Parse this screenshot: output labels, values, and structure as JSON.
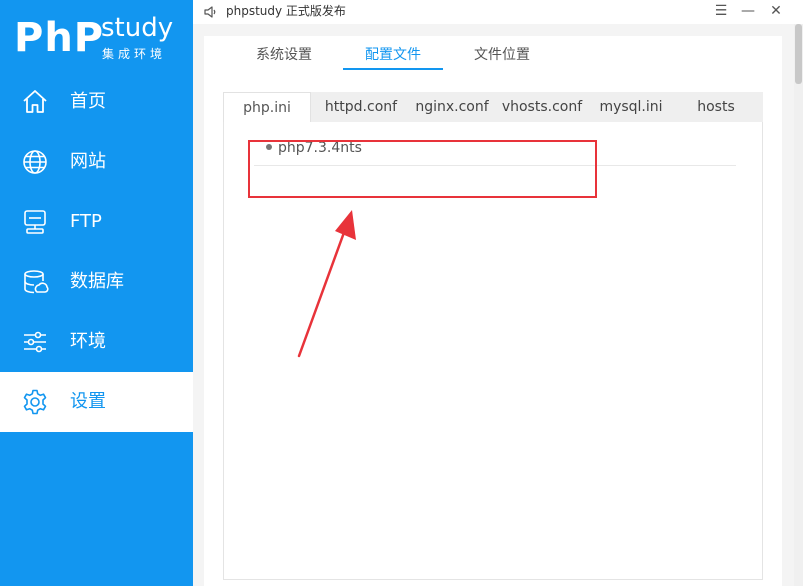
{
  "logo": {
    "php": "PhP",
    "study": "study",
    "sub": "集成环境"
  },
  "sidebar": {
    "items": [
      {
        "label": "首页",
        "icon": "home-icon"
      },
      {
        "label": "网站",
        "icon": "globe-icon"
      },
      {
        "label": "FTP",
        "icon": "server-icon"
      },
      {
        "label": "数据库",
        "icon": "database-icon"
      },
      {
        "label": "环境",
        "icon": "sliders-icon"
      },
      {
        "label": "设置",
        "icon": "gear-icon",
        "active": true
      }
    ]
  },
  "titlebar": {
    "title": "phpstudy 正式版发布",
    "menu": "☰",
    "minimize": "—",
    "close": "✕"
  },
  "top_tabs": [
    {
      "label": "系统设置"
    },
    {
      "label": "配置文件",
      "active": true
    },
    {
      "label": "文件位置"
    }
  ],
  "sub_tabs": [
    {
      "label": "php.ini",
      "active": true
    },
    {
      "label": "httpd.conf"
    },
    {
      "label": "nginx.conf"
    },
    {
      "label": "vhosts.conf"
    },
    {
      "label": "mysql.ini"
    },
    {
      "label": "hosts"
    }
  ],
  "list": [
    {
      "label": "php7.3.4nts"
    }
  ],
  "colors": {
    "brand": "#1296f0",
    "annotation": "#e8333a"
  }
}
